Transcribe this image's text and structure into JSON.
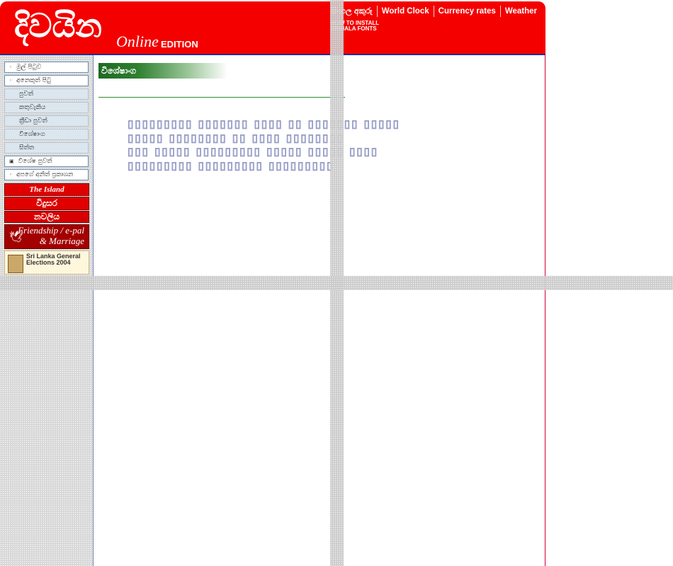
{
  "header": {
    "logo": "දිවයින",
    "logo_online": "Online",
    "logo_edition": "EDITION",
    "topnav": [
      "සිංහල අකුරු",
      "World Clock",
      "Currency rates",
      "Weather"
    ],
    "install_line1": "HOW TO INSTALL",
    "install_line2": "SINHALA FONTS"
  },
  "sidebar": {
    "items": [
      {
        "label": "මුල් පිටුව",
        "sub": false
      },
      {
        "label": "අනෙකුත් පිටු",
        "sub": false
      },
      {
        "label": "පුවත්",
        "sub": true
      },
      {
        "label": "කතුවැකිය",
        "sub": true
      },
      {
        "label": "ක්‍රීඩා පුවත්",
        "sub": true
      },
      {
        "label": "විශේෂාංග",
        "sub": true
      },
      {
        "label": "සිත්ත",
        "sub": true
      },
      {
        "label": "විශේෂ පුවත්",
        "sub": false
      },
      {
        "label": "අපගේ අනිත් ප්‍රකාශන",
        "sub": false
      }
    ],
    "banners": {
      "island": "The Island",
      "vidusara": "විදුසර",
      "navaliya": "නවලිය",
      "friendship_line1": "Friendship / e-pal",
      "friendship_line2": "& Marriage",
      "election": "Sri Lanka General Elections 2004"
    }
  },
  "content": {
    "section_title": "විශේෂාංග"
  }
}
